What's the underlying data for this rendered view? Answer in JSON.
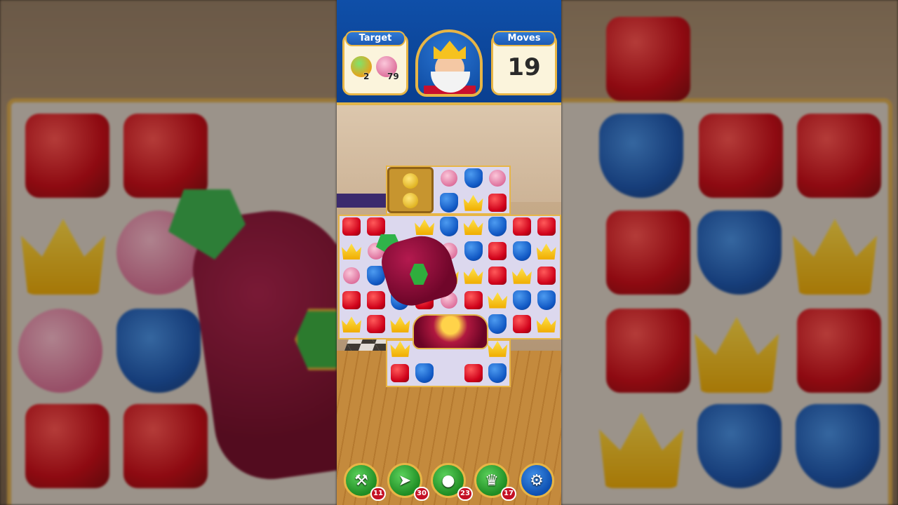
{
  "hud": {
    "target_label": "Target",
    "moves_label": "Moves",
    "moves_value": "19",
    "targets": [
      {
        "icon": "potion-icon",
        "count": "2"
      },
      {
        "icon": "shell-icon",
        "count": "79"
      }
    ]
  },
  "boosters": [
    {
      "icon": "hammer-icon",
      "count": "11"
    },
    {
      "icon": "arrow-icon",
      "count": "30"
    },
    {
      "icon": "cannon-icon",
      "count": "23"
    },
    {
      "icon": "jester-hat-icon",
      "count": "17"
    },
    {
      "icon": "gear-icon",
      "count": ""
    }
  ],
  "board": {
    "rows": [
      [
        "",
        "",
        "crate",
        "crate",
        "pink",
        "blue",
        "pink",
        "",
        ""
      ],
      [
        "",
        "",
        "crate",
        "crate",
        "blue",
        "yellow",
        "red",
        "",
        ""
      ],
      [
        "red",
        "red",
        "",
        "yellow",
        "blue",
        "yellow",
        "blue",
        "red",
        "red"
      ],
      [
        "yellow",
        "pink",
        "",
        "",
        "pink",
        "blue",
        "red",
        "blue",
        "yellow"
      ],
      [
        "pink",
        "blue",
        "",
        "",
        "yellow",
        "yellow",
        "red",
        "yellow",
        "red"
      ],
      [
        "red",
        "red",
        "blue",
        "red",
        "pink",
        "red",
        "yellow",
        "blue",
        "blue"
      ],
      [
        "yellow",
        "red",
        "yellow",
        "yellow",
        "",
        "",
        "blue",
        "red",
        "yellow"
      ],
      [
        "",
        "",
        "yellow",
        "",
        "",
        "",
        "yellow",
        "",
        ""
      ],
      [
        "",
        "",
        "red",
        "blue",
        "",
        "red",
        "blue",
        "",
        ""
      ]
    ]
  },
  "colors": {
    "hud_blue": "#0f4fa8",
    "gold": "#e7b546",
    "red_tile": "#d0021b",
    "blue_tile": "#1158c4",
    "yellow_tile": "#f0ac00",
    "pink_tile": "#dc6c99"
  }
}
